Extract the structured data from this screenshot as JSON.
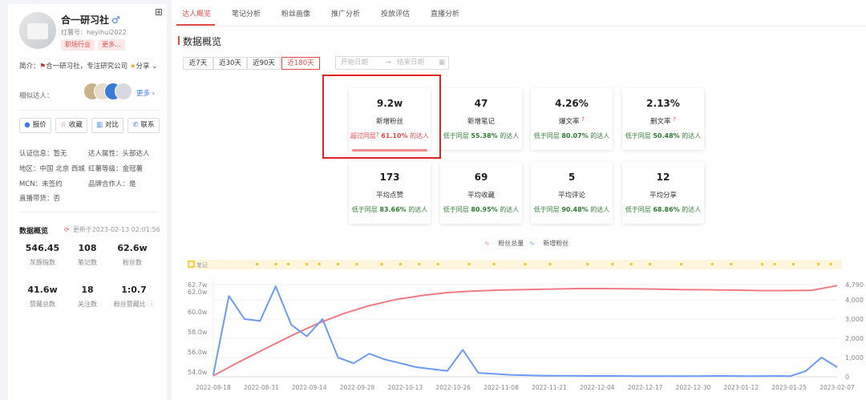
{
  "profile": {
    "name": "合一研习社",
    "gender_icon": "male-symbol-icon",
    "redbook_id": "红薯号：heyihui2022",
    "tags": [
      "职场行业",
      "更多..."
    ],
    "intro_label": "简介：",
    "intro_text": "合一研习社，专注研究公司",
    "intro_more": "分享",
    "similar_label": "相似达人：",
    "more_link": "更多",
    "buttons": [
      "报价",
      "收藏",
      "对比",
      "联系"
    ],
    "info": [
      {
        "label": "认证信息：",
        "value": "暂无"
      },
      {
        "label": "达人属性：",
        "value": "头部达人"
      },
      {
        "label": "地区：",
        "value": "中国 北京 西城"
      },
      {
        "label": "红薯等级：",
        "value": "金冠薯"
      },
      {
        "label": "MCN：",
        "value": "未签约"
      },
      {
        "label": "品牌合作人：",
        "value": "是"
      },
      {
        "label": "直播带货：",
        "value": "否"
      }
    ],
    "overview_title": "数据概览",
    "updated": "更新于2023-02-13 02:01:56",
    "stats": [
      {
        "value": "546.45",
        "label": "灰豚指数"
      },
      {
        "value": "108",
        "label": "笔记数"
      },
      {
        "value": "62.6w",
        "label": "粉丝数"
      },
      {
        "value": "41.6w",
        "label": "赞藏总数"
      },
      {
        "value": "18",
        "label": "关注数"
      },
      {
        "value": "1:0.7",
        "label": "粉丝赞藏比"
      }
    ]
  },
  "tabs": [
    "达人概览",
    "笔记分析",
    "粉丝画像",
    "推广分析",
    "投放评估",
    "直播分析"
  ],
  "section_title": "数据概览",
  "ranges": [
    "近7天",
    "近30天",
    "近90天",
    "近180天"
  ],
  "date_range": {
    "start": "开始日期",
    "arrow": "→",
    "end": "结束日期"
  },
  "cards": [
    {
      "value": "9.2w",
      "label": "新增粉丝",
      "sub_prefix": "超过同层",
      "sub_pct": "61.10%",
      "sub_suffix": "的达人",
      "hot": true
    },
    {
      "value": "47",
      "label": "新增笔记",
      "sub_prefix": "低于同层",
      "sub_pct": "55.38%",
      "sub_suffix": "的达人"
    },
    {
      "value": "4.26%",
      "label": "爆文率",
      "sub_prefix": "低于同层",
      "sub_pct": "80.07%",
      "sub_suffix": "的达人"
    },
    {
      "value": "2.13%",
      "label": "删文率",
      "sub_prefix": "低于同层",
      "sub_pct": "50.48%",
      "sub_suffix": "的达人"
    },
    {
      "value": "173",
      "label": "平均点赞",
      "sub_prefix": "低于同层",
      "sub_pct": "83.66%",
      "sub_suffix": "的达人"
    },
    {
      "value": "69",
      "label": "平均收藏",
      "sub_prefix": "低于同层",
      "sub_pct": "80.95%",
      "sub_suffix": "的达人"
    },
    {
      "value": "5",
      "label": "平均评论",
      "sub_prefix": "低于同层",
      "sub_pct": "90.48%",
      "sub_suffix": "的达人"
    },
    {
      "value": "12",
      "label": "平均分享",
      "sub_prefix": "低于同层",
      "sub_pct": "68.86%",
      "sub_suffix": "的达人"
    }
  ],
  "legend": [
    "粉丝总量",
    "新增粉丝"
  ],
  "notes_label": "笔记",
  "colors": {
    "accent": "#e84a4a",
    "total_line": "#f07b82",
    "new_line": "#6c9af5",
    "note_dot": "#f5c518"
  },
  "chart_data": {
    "type": "line",
    "x_ticks": [
      "2022-08-18",
      "2022-08-31",
      "2022-09-14",
      "2022-09-28",
      "2022-10-13",
      "2022-10-26",
      "2022-11-08",
      "2022-11-21",
      "2022-12-04",
      "2022-12-17",
      "2022-12-30",
      "2023-01-12",
      "2023-01-25",
      "2023-02-07"
    ],
    "y_left_ticks": [
      "62.7w",
      "62.0w",
      "60.0w",
      "58.0w",
      "56.0w",
      "54.0w"
    ],
    "y_right_ticks": [
      "4,790",
      "4,000",
      "3,000",
      "2,000",
      "1,000",
      "0"
    ],
    "y_left_range": [
      53.5,
      62.7
    ],
    "y_right_range": [
      0,
      4790
    ],
    "series": [
      {
        "name": "粉丝总量",
        "axis": "left",
        "values": [
          53.6,
          55.0,
          56.3,
          57.6,
          58.8,
          59.8,
          60.6,
          61.2,
          61.6,
          61.9,
          62.05,
          62.15,
          62.2,
          62.25,
          62.3,
          62.3,
          62.28,
          62.25,
          62.2,
          62.18,
          62.15,
          62.1,
          62.1,
          62.12,
          62.6
        ]
      },
      {
        "name": "新增粉丝",
        "axis": "right",
        "values": [
          100,
          4200,
          3000,
          2900,
          4700,
          2700,
          2100,
          3000,
          1000,
          700,
          1200,
          900,
          700,
          500,
          400,
          300,
          1400,
          200,
          150,
          100,
          80,
          60,
          50,
          50,
          40,
          40,
          40,
          30,
          30,
          30,
          30,
          30,
          40,
          40,
          30,
          30,
          40,
          30,
          300,
          1000,
          500
        ]
      }
    ],
    "note_positions": [
      0.07,
      0.1,
      0.12,
      0.15,
      0.17,
      0.2,
      0.23,
      0.27,
      0.3,
      0.33,
      0.36,
      0.41,
      0.45,
      0.5,
      0.54,
      0.6,
      0.64,
      0.67,
      0.7,
      0.75,
      0.8,
      0.83,
      0.88,
      0.9,
      0.93,
      0.97,
      0.99
    ]
  }
}
